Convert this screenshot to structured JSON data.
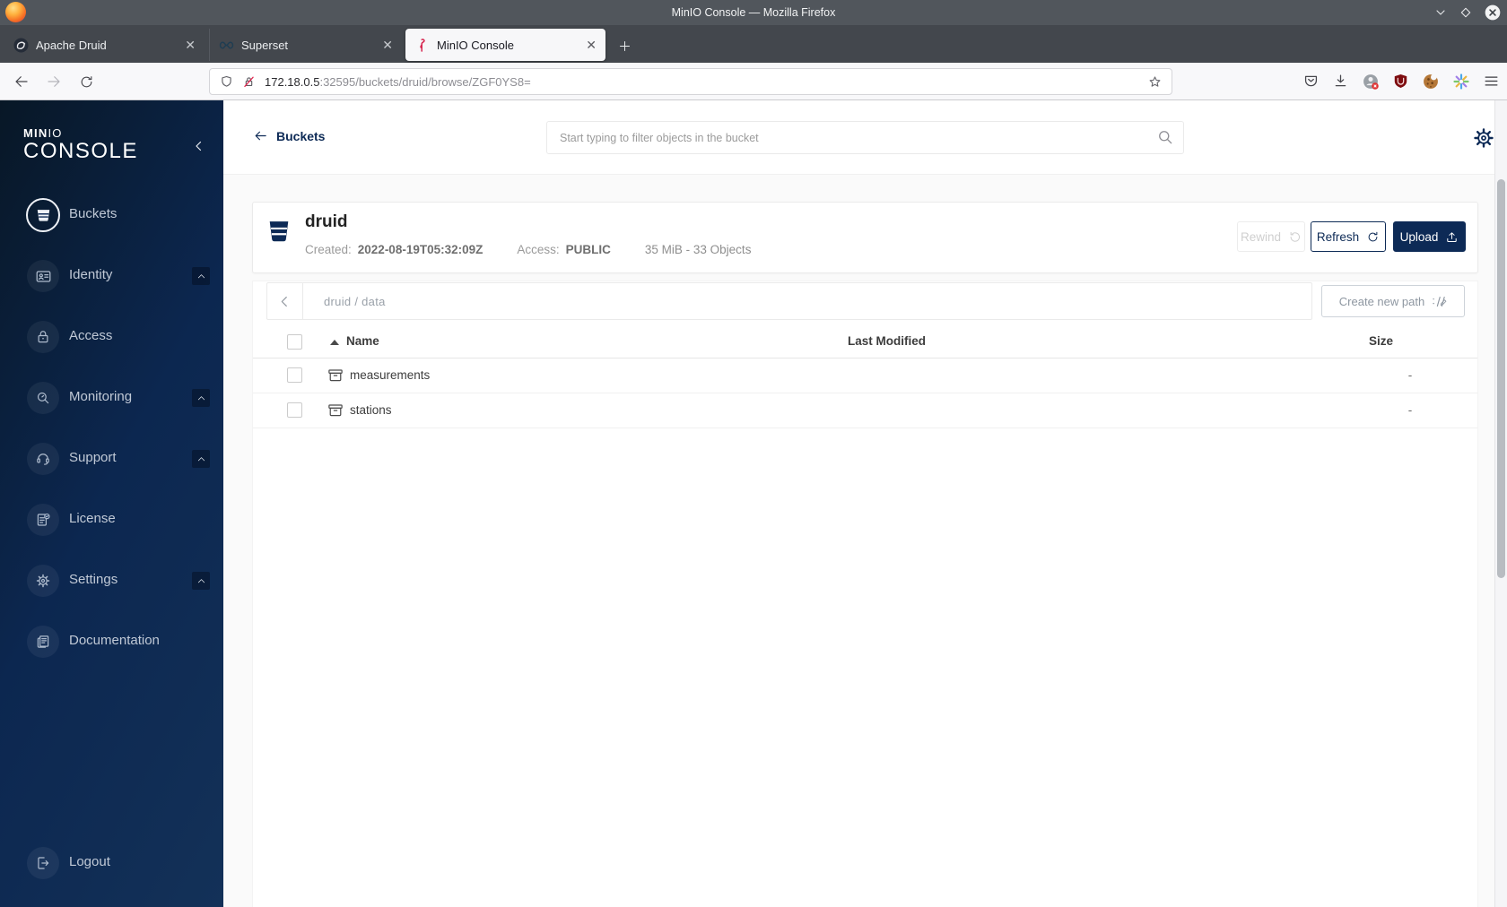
{
  "window": {
    "title": "MinIO Console — Mozilla Firefox",
    "controls": [
      "minimize-icon",
      "maximize-icon",
      "close-icon"
    ]
  },
  "browser": {
    "tabs": [
      {
        "label": "Apache Druid",
        "favicon": "druid-favicon",
        "active": false
      },
      {
        "label": "Superset",
        "favicon": "superset-favicon",
        "active": false
      },
      {
        "label": "MinIO Console",
        "favicon": "minio-favicon",
        "active": true
      }
    ],
    "url": {
      "host": "172.18.0.5",
      "rest": ":32595/buckets/druid/browse/ZGF0YS8="
    },
    "toolbar_icons": [
      "pocket-icon",
      "download-icon",
      "extension-icon",
      "ublock-icon",
      "cookie-icon",
      "theme-icon",
      "menu-icon"
    ]
  },
  "sidebar": {
    "logo": {
      "top_bold": "MIN",
      "top_light": "IO",
      "bottom": "CONSOLE"
    },
    "items": [
      {
        "label": "Buckets",
        "icon": "bucket-icon",
        "active": true,
        "expandable": false
      },
      {
        "label": "Identity",
        "icon": "identity-icon",
        "active": false,
        "expandable": true
      },
      {
        "label": "Access",
        "icon": "access-icon",
        "active": false,
        "expandable": false
      },
      {
        "label": "Monitoring",
        "icon": "monitoring-icon",
        "active": false,
        "expandable": true
      },
      {
        "label": "Support",
        "icon": "support-icon",
        "active": false,
        "expandable": true
      },
      {
        "label": "License",
        "icon": "license-icon",
        "active": false,
        "expandable": false
      },
      {
        "label": "Settings",
        "icon": "settings-icon",
        "active": false,
        "expandable": true
      },
      {
        "label": "Documentation",
        "icon": "documentation-icon",
        "active": false,
        "expandable": false
      }
    ],
    "logout_label": "Logout"
  },
  "header": {
    "back_label": "Buckets",
    "search_placeholder": "Start typing to filter objects in the bucket"
  },
  "bucket": {
    "name": "druid",
    "created_label": "Created:",
    "created_value": "2022-08-19T05:32:09Z",
    "access_label": "Access:",
    "access_value": "PUBLIC",
    "summary": "35 MiB - 33 Objects",
    "buttons": {
      "rewind": "Rewind",
      "refresh": "Refresh",
      "upload": "Upload"
    }
  },
  "path_bar": {
    "breadcrumb": "druid / data",
    "create_path_label": "Create new path"
  },
  "table": {
    "columns": {
      "name": "Name",
      "last_modified": "Last Modified",
      "size": "Size"
    },
    "rows": [
      {
        "name": "measurements",
        "last_modified": "",
        "size": "-"
      },
      {
        "name": "stations",
        "last_modified": "",
        "size": "-"
      }
    ]
  },
  "colors": {
    "accent_navy": "#0d2a56",
    "sidebar_gradient_start": "#081726",
    "sidebar_gradient_end": "#133158",
    "page_background": "#fafafa",
    "titlebar": "#51565c",
    "insecure_red": "#e22850"
  }
}
